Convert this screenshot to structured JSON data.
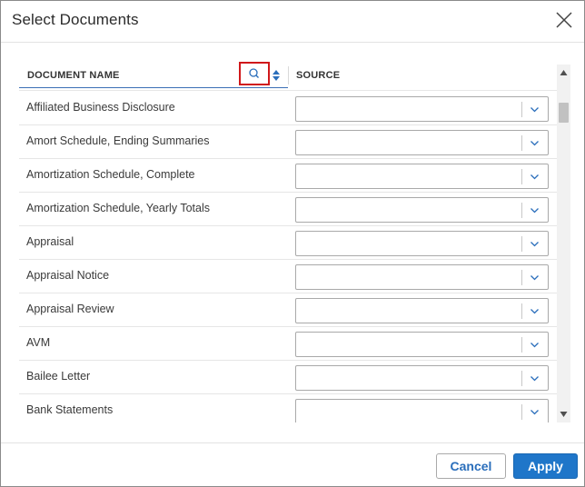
{
  "dialog": {
    "title": "Select Documents",
    "cancel_label": "Cancel",
    "apply_label": "Apply"
  },
  "table": {
    "col_document_name": "DOCUMENT NAME",
    "col_source": "SOURCE",
    "rows": [
      {
        "name": "Affiliated Business Disclosure",
        "source": ""
      },
      {
        "name": "Amort Schedule, Ending Summaries",
        "source": ""
      },
      {
        "name": "Amortization Schedule, Complete",
        "source": ""
      },
      {
        "name": "Amortization Schedule, Yearly Totals",
        "source": ""
      },
      {
        "name": "Appraisal",
        "source": ""
      },
      {
        "name": "Appraisal Notice",
        "source": ""
      },
      {
        "name": "Appraisal Review",
        "source": ""
      },
      {
        "name": "AVM",
        "source": ""
      },
      {
        "name": "Bailee Letter",
        "source": ""
      },
      {
        "name": "Bank Statements",
        "source": ""
      }
    ]
  },
  "icons": {
    "close": "close-icon",
    "search": "search-icon",
    "sort": "sort-icon",
    "dropdown": "chevron-down-icon"
  },
  "colors": {
    "primary": "#1f76c9",
    "highlight_border": "#d0181b",
    "header_underline": "#3b6fb6"
  }
}
